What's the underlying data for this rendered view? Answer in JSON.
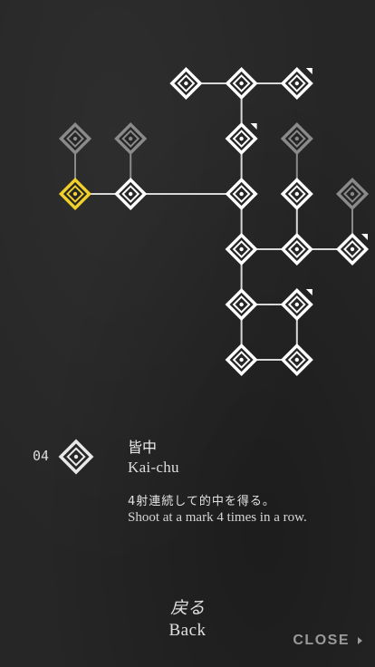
{
  "colors": {
    "background": "#262626",
    "active_node": "#ffffff",
    "locked_node": "#8a8a8a",
    "selected_node": "#f2d02c",
    "line": "#d8d8d8",
    "locked_line": "#8a8a8a",
    "corner_mark": "#ffffff"
  },
  "skill_tree": {
    "nodes": [
      {
        "id": "a1",
        "col": 2,
        "row": 0,
        "state": "active",
        "icon": "target-diamond-icon"
      },
      {
        "id": "a2",
        "col": 3,
        "row": 0,
        "state": "active",
        "icon": "target-diamond-icon"
      },
      {
        "id": "a3",
        "col": 4,
        "row": 0,
        "state": "active",
        "icon": "target-diamond-icon",
        "corner_mark": true
      },
      {
        "id": "b0",
        "col": 0,
        "row": 1,
        "state": "locked",
        "icon": "target-diamond-icon"
      },
      {
        "id": "b1",
        "col": 1,
        "row": 1,
        "state": "locked",
        "icon": "target-diamond-icon"
      },
      {
        "id": "b2",
        "col": 3,
        "row": 1,
        "state": "active",
        "icon": "target-diamond-icon",
        "corner_mark": true
      },
      {
        "id": "b3",
        "col": 4,
        "row": 1,
        "state": "locked",
        "icon": "target-diamond-icon"
      },
      {
        "id": "c0",
        "col": 0,
        "row": 2,
        "state": "selected",
        "icon": "target-diamond-icon"
      },
      {
        "id": "c1",
        "col": 1,
        "row": 2,
        "state": "active",
        "icon": "target-diamond-icon"
      },
      {
        "id": "c2",
        "col": 3,
        "row": 2,
        "state": "active",
        "icon": "target-diamond-icon"
      },
      {
        "id": "c3",
        "col": 4,
        "row": 2,
        "state": "active",
        "icon": "target-diamond-icon"
      },
      {
        "id": "c4",
        "col": 5,
        "row": 2,
        "state": "locked",
        "icon": "target-diamond-icon"
      },
      {
        "id": "d1",
        "col": 3,
        "row": 3,
        "state": "active",
        "icon": "target-diamond-icon"
      },
      {
        "id": "d2",
        "col": 4,
        "row": 3,
        "state": "active",
        "icon": "target-diamond-icon"
      },
      {
        "id": "d3",
        "col": 5,
        "row": 3,
        "state": "active",
        "icon": "target-diamond-icon",
        "corner_mark": true
      },
      {
        "id": "e1",
        "col": 3,
        "row": 4,
        "state": "active",
        "icon": "target-diamond-icon"
      },
      {
        "id": "e2",
        "col": 4,
        "row": 4,
        "state": "active",
        "icon": "target-diamond-icon",
        "corner_mark": true
      },
      {
        "id": "f1",
        "col": 3,
        "row": 5,
        "state": "active",
        "icon": "target-diamond-icon"
      },
      {
        "id": "f2",
        "col": 4,
        "row": 5,
        "state": "active",
        "icon": "target-diamond-icon"
      }
    ],
    "edges": [
      [
        "a1",
        "a2"
      ],
      [
        "a2",
        "a3"
      ],
      [
        "a2",
        "b2"
      ],
      [
        "b0",
        "c0"
      ],
      [
        "b1",
        "c1"
      ],
      [
        "b3",
        "c3"
      ],
      [
        "c0",
        "c1"
      ],
      [
        "c1",
        "c2"
      ],
      [
        "b2",
        "c2"
      ],
      [
        "c2",
        "d1"
      ],
      [
        "c3",
        "d2"
      ],
      [
        "c4",
        "d3"
      ],
      [
        "d1",
        "d2"
      ],
      [
        "d2",
        "d3"
      ],
      [
        "d1",
        "e1"
      ],
      [
        "e1",
        "e2"
      ],
      [
        "e1",
        "f1"
      ],
      [
        "e2",
        "f2"
      ],
      [
        "f1",
        "f2"
      ]
    ]
  },
  "detail": {
    "number": "04",
    "icon": "target-diamond-icon",
    "title_jp": "皆中",
    "title_en": "Kai-chu",
    "description_jp": "4射連続して的中を得る。",
    "description_en": "Shoot at a mark 4 times in a row."
  },
  "back": {
    "label_jp": "戻る",
    "label_en": "Back"
  },
  "close": {
    "label": "CLOSE"
  }
}
